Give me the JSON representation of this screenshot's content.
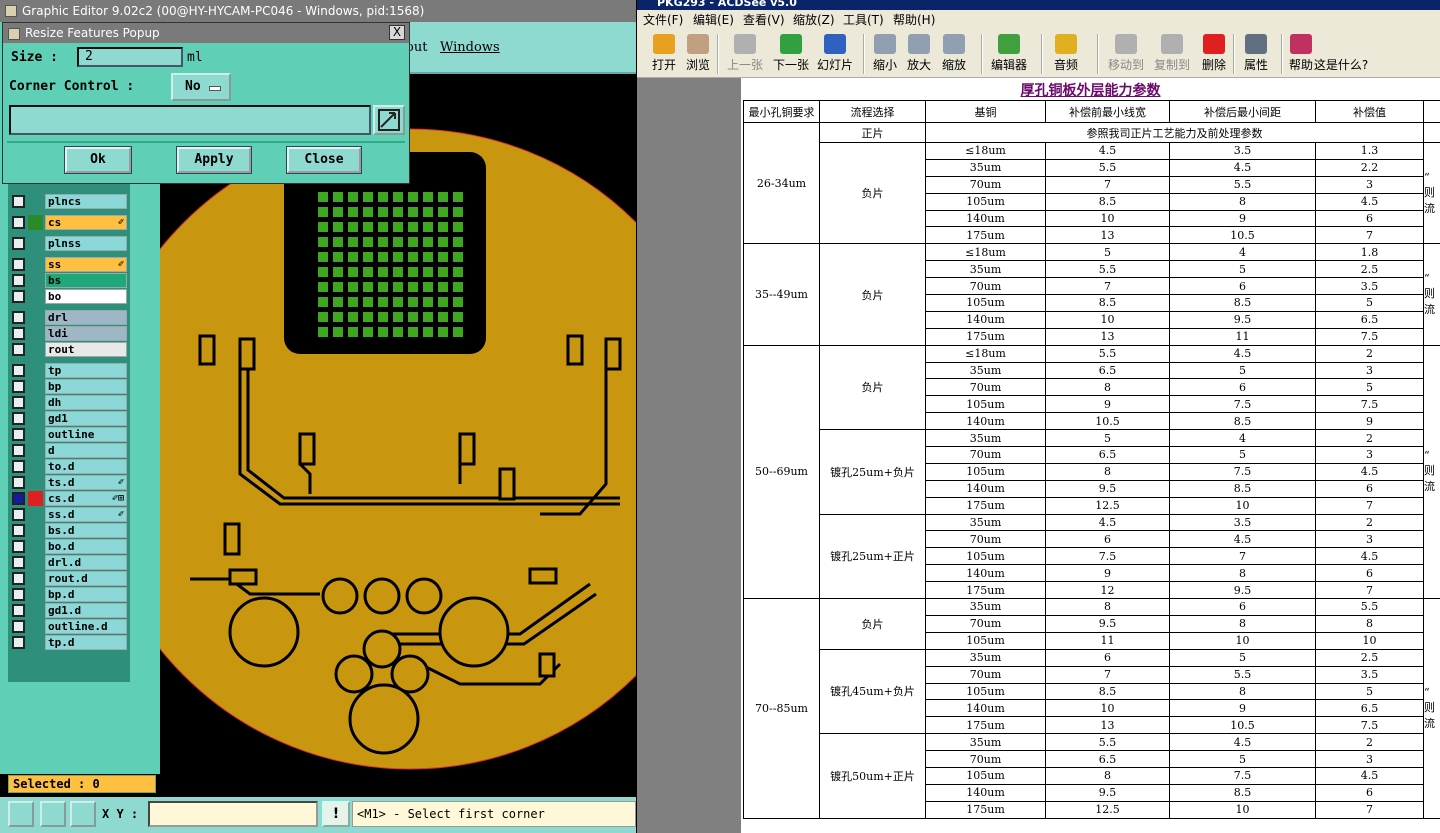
{
  "graphic_editor": {
    "title": "Graphic Editor 9.02c2 (00@HY-HYCAM-PC046 - Windows, pid:1568)",
    "menu": [
      "out",
      "Windows"
    ],
    "layers": [
      {
        "name": "plncs",
        "cls": ""
      },
      {
        "name": "cs",
        "cls": "cs",
        "mark": "✐"
      },
      {
        "name": "plnss",
        "cls": ""
      },
      {
        "name": "ss",
        "cls": "ss",
        "mark": "✐"
      },
      {
        "name": "bs",
        "cls": "bs"
      },
      {
        "name": "bo",
        "cls": "bo"
      },
      {
        "name": "drl",
        "cls": "drl"
      },
      {
        "name": "ldi",
        "cls": "ldi"
      },
      {
        "name": "rout",
        "cls": "rout"
      },
      {
        "name": "tp",
        "cls": ""
      },
      {
        "name": "bp",
        "cls": ""
      },
      {
        "name": "dh",
        "cls": ""
      },
      {
        "name": "gd1",
        "cls": ""
      },
      {
        "name": "outline",
        "cls": ""
      },
      {
        "name": "d",
        "cls": ""
      },
      {
        "name": "to.d",
        "cls": ""
      },
      {
        "name": "ts.d",
        "cls": "",
        "mark": "✐"
      },
      {
        "name": "cs.d",
        "cls": "csd",
        "mark": "✐⊞"
      },
      {
        "name": "ss.d",
        "cls": "",
        "mark": "✐"
      },
      {
        "name": "bs.d",
        "cls": ""
      },
      {
        "name": "bo.d",
        "cls": ""
      },
      {
        "name": "drl.d",
        "cls": ""
      },
      {
        "name": "rout.d",
        "cls": ""
      },
      {
        "name": "bp.d",
        "cls": ""
      },
      {
        "name": "gd1.d",
        "cls": ""
      },
      {
        "name": "outline.d",
        "cls": ""
      },
      {
        "name": "tp.d",
        "cls": ""
      }
    ],
    "selected_label": "Selected : 0",
    "xy_label": "X Y :",
    "xy_button": "!",
    "hint": "<M1> - Select first corner",
    "colors": {
      "board": "#c8960f",
      "pads": "#3fa61f",
      "accent": "#5fd0b5"
    }
  },
  "resize_popup": {
    "title": "Resize Features Popup",
    "close_x": "X",
    "size_label": "Size :",
    "size_value": "2",
    "size_unit": "ml",
    "corner_label": "Corner Control :",
    "corner_value": "No",
    "ok": "Ok",
    "apply": "Apply",
    "close": "Close"
  },
  "acdsee": {
    "title": "PKG293 - ACDSee v5.0",
    "menu": [
      "文件(F)",
      "编辑(E)",
      "查看(V)",
      "缩放(Z)",
      "工具(T)",
      "帮助(H)"
    ],
    "toolbar": [
      {
        "label": "打开",
        "icon": "open-folder-icon",
        "color": "#e8a020",
        "enabled": true
      },
      {
        "label": "浏览",
        "icon": "browse-icon",
        "color": "#c0a080",
        "enabled": true
      },
      {
        "label": "上一张",
        "icon": "prev-image-icon",
        "color": "#b0b0b0",
        "enabled": false
      },
      {
        "label": "下一张",
        "icon": "next-image-icon",
        "color": "#30a040",
        "enabled": true
      },
      {
        "label": "幻灯片",
        "icon": "slideshow-icon",
        "color": "#3060c0",
        "enabled": true
      },
      {
        "label": "缩小",
        "icon": "zoom-out-icon",
        "color": "#90a0b0",
        "enabled": true
      },
      {
        "label": "放大",
        "icon": "zoom-in-icon",
        "color": "#90a0b0",
        "enabled": true
      },
      {
        "label": "缩放",
        "icon": "zoom-icon",
        "color": "#90a0b0",
        "enabled": true
      },
      {
        "label": "编辑器",
        "icon": "editor-icon",
        "color": "#40a040",
        "enabled": true
      },
      {
        "label": "音频",
        "icon": "audio-icon",
        "color": "#e0b020",
        "enabled": true
      },
      {
        "label": "移动到",
        "icon": "move-to-icon",
        "color": "#b0b0b0",
        "enabled": false
      },
      {
        "label": "复制到",
        "icon": "copy-to-icon",
        "color": "#b0b0b0",
        "enabled": false
      },
      {
        "label": "删除",
        "icon": "delete-icon",
        "color": "#e02020",
        "enabled": true
      },
      {
        "label": "属性",
        "icon": "properties-icon",
        "color": "#607080",
        "enabled": true
      },
      {
        "label": "帮助",
        "icon": "help-book-icon",
        "color": "#c03060",
        "enabled": true
      },
      {
        "label": "这是什么?",
        "icon": "whats-this-icon",
        "color": "#ece9d8",
        "enabled": true
      }
    ],
    "sheet_title": "厚孔铜板外层能力参数",
    "headers": [
      "最小孔铜要求",
      "流程选择",
      "基铜",
      "补偿前最小线宽",
      "补偿后最小间距",
      "补偿值"
    ],
    "positive_note": "参照我司正片工艺能力及前处理参数",
    "side_notes": [
      "“ 则 流",
      "“ 则 流",
      "“ 则 流"
    ],
    "groups": [
      {
        "req": "26-34um",
        "procs": [
          {
            "name": "正片",
            "rows": []
          },
          {
            "name": "负片",
            "rows": [
              [
                "≤18um",
                "4.5",
                "3.5",
                "1.3"
              ],
              [
                "35um",
                "5.5",
                "4.5",
                "2.2"
              ],
              [
                "70um",
                "7",
                "5.5",
                "3"
              ],
              [
                "105um",
                "8.5",
                "8",
                "4.5"
              ],
              [
                "140um",
                "10",
                "9",
                "6"
              ],
              [
                "175um",
                "13",
                "10.5",
                "7"
              ]
            ]
          }
        ]
      },
      {
        "req": "35--49um",
        "procs": [
          {
            "name": "负片",
            "rows": [
              [
                "≤18um",
                "5",
                "4",
                "1.8"
              ],
              [
                "35um",
                "5.5",
                "5",
                "2.5"
              ],
              [
                "70um",
                "7",
                "6",
                "3.5"
              ],
              [
                "105um",
                "8.5",
                "8.5",
                "5"
              ],
              [
                "140um",
                "10",
                "9.5",
                "6.5"
              ],
              [
                "175um",
                "13",
                "11",
                "7.5"
              ]
            ]
          }
        ]
      },
      {
        "req": "50--69um",
        "procs": [
          {
            "name": "负片",
            "rows": [
              [
                "≤18um",
                "5.5",
                "4.5",
                "2"
              ],
              [
                "35um",
                "6.5",
                "5",
                "3"
              ],
              [
                "70um",
                "8",
                "6",
                "5"
              ],
              [
                "105um",
                "9",
                "7.5",
                "7.5"
              ],
              [
                "140um",
                "10.5",
                "8.5",
                "9"
              ]
            ]
          },
          {
            "name": "镀孔25um+负片",
            "rows": [
              [
                "35um",
                "5",
                "4",
                "2"
              ],
              [
                "70um",
                "6.5",
                "5",
                "3"
              ],
              [
                "105um",
                "8",
                "7.5",
                "4.5"
              ],
              [
                "140um",
                "9.5",
                "8.5",
                "6"
              ],
              [
                "175um",
                "12.5",
                "10",
                "7"
              ]
            ]
          },
          {
            "name": "镀孔25um+正片",
            "rows": [
              [
                "35um",
                "4.5",
                "3.5",
                "2"
              ],
              [
                "70um",
                "6",
                "4.5",
                "3"
              ],
              [
                "105um",
                "7.5",
                "7",
                "4.5"
              ],
              [
                "140um",
                "9",
                "8",
                "6"
              ],
              [
                "175um",
                "12",
                "9.5",
                "7"
              ]
            ]
          }
        ]
      },
      {
        "req": "70--85um",
        "procs": [
          {
            "name": "负片",
            "rows": [
              [
                "35um",
                "8",
                "6",
                "5.5"
              ],
              [
                "70um",
                "9.5",
                "8",
                "8"
              ],
              [
                "105um",
                "11",
                "10",
                "10"
              ]
            ]
          },
          {
            "name": "镀孔45um+负片",
            "rows": [
              [
                "35um",
                "6",
                "5",
                "2.5"
              ],
              [
                "70um",
                "7",
                "5.5",
                "3.5"
              ],
              [
                "105um",
                "8.5",
                "8",
                "5"
              ],
              [
                "140um",
                "10",
                "9",
                "6.5"
              ],
              [
                "175um",
                "13",
                "10.5",
                "7.5"
              ]
            ]
          },
          {
            "name": "镀孔50um+正片",
            "rows": [
              [
                "35um",
                "5.5",
                "4.5",
                "2"
              ],
              [
                "70um",
                "6.5",
                "5",
                "3"
              ],
              [
                "105um",
                "8",
                "7.5",
                "4.5"
              ],
              [
                "140um",
                "9.5",
                "8.5",
                "6"
              ],
              [
                "175um",
                "12.5",
                "10",
                "7"
              ]
            ]
          }
        ]
      }
    ]
  }
}
